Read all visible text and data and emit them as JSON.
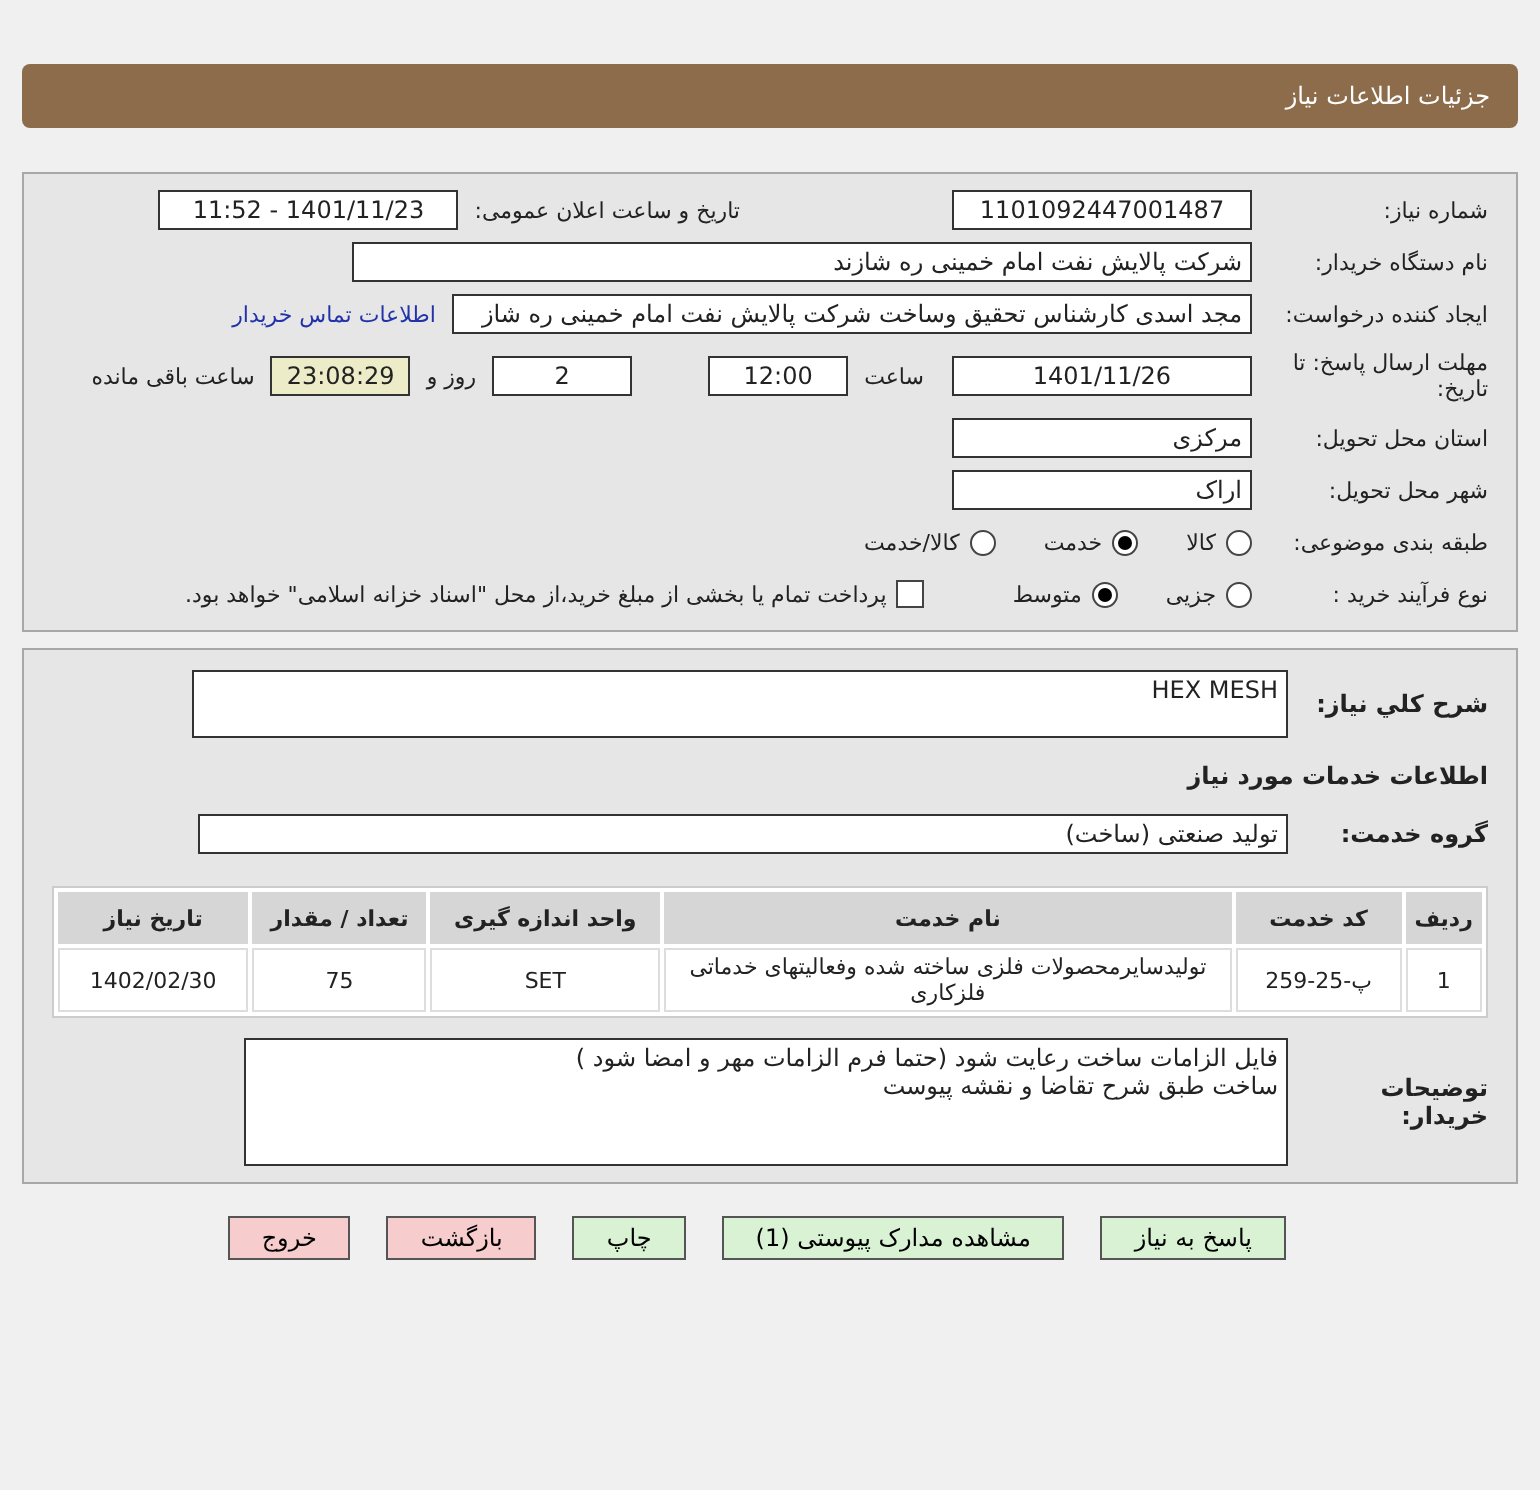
{
  "header": {
    "title": "جزئیات اطلاعات نیاز"
  },
  "details": {
    "need_number": {
      "label": "شماره نیاز:",
      "value": "1101092447001487"
    },
    "announce": {
      "label": "تاریخ و ساعت اعلان عمومی:",
      "value": "1401/11/23 - 11:52"
    },
    "buyer": {
      "label": "نام دستگاه خریدار:",
      "value": "شرکت پالایش نفت امام خمینی  ره  شازند"
    },
    "requester": {
      "label": "ایجاد کننده درخواست:",
      "value": "مجد اسدی کارشناس تحقیق وساخت شرکت پالایش نفت امام خمینی  ره  شاز",
      "link": "اطلاعات تماس خریدار"
    },
    "deadline": {
      "label": "مهلت ارسال پاسخ: تا تاریخ:",
      "date": "1401/11/26",
      "time_label": "ساعت",
      "time": "12:00",
      "days": "2",
      "days_label": "روز و",
      "remaining": "23:08:29",
      "remaining_label": "ساعت باقی مانده"
    },
    "province": {
      "label": "استان محل تحویل:",
      "value": "مرکزی"
    },
    "city": {
      "label": "شهر محل تحویل:",
      "value": "اراک"
    },
    "category": {
      "label": "طبقه بندی موضوعی:",
      "options": [
        {
          "label": "کالا",
          "selected": false
        },
        {
          "label": "خدمت",
          "selected": true
        },
        {
          "label": "کالا/خدمت",
          "selected": false
        }
      ]
    },
    "process": {
      "label": "نوع فرآیند خرید :",
      "options": [
        {
          "label": "جزیی",
          "selected": false
        },
        {
          "label": "متوسط",
          "selected": true
        }
      ],
      "payment": {
        "label": "پرداخت تمام یا بخشی از مبلغ خرید،از محل \"اسناد خزانه اسلامی\" خواهد بود.",
        "checked": false
      }
    }
  },
  "description": {
    "label": "شرح کلي نياز:",
    "value": "HEX MESH"
  },
  "services_heading": "اطلاعات خدمات مورد نیاز",
  "service_group": {
    "label": "گروه خدمت:",
    "value": "تولید صنعتی (ساخت)"
  },
  "table": {
    "columns": [
      "ردیف",
      "کد خدمت",
      "نام خدمت",
      "واحد اندازه گیری",
      "تعداد / مقدار",
      "تاریخ نیاز"
    ],
    "rows": [
      [
        "1",
        "پ-25-259",
        "تولیدسایرمحصولات فلزی ساخته شده وفعالیتهای خدماتی فلزکاری",
        "SET",
        "75",
        "1402/02/30"
      ]
    ]
  },
  "buyer_notes": {
    "label": "توضیحات خریدار:",
    "lines": [
      "فایل الزامات ساخت رعایت شود (حتما فرم الزامات مهر و امضا شود )",
      "ساخت طبق شرح تقاضا و نقشه پیوست"
    ]
  },
  "buttons": [
    {
      "label": "پاسخ به نیاز",
      "kind": "green"
    },
    {
      "label": "مشاهده مدارک پیوستی (1)",
      "kind": "green"
    },
    {
      "label": "چاپ",
      "kind": "green"
    },
    {
      "label": "بازگشت",
      "kind": "pink"
    },
    {
      "label": "خروج",
      "kind": "pink"
    }
  ]
}
